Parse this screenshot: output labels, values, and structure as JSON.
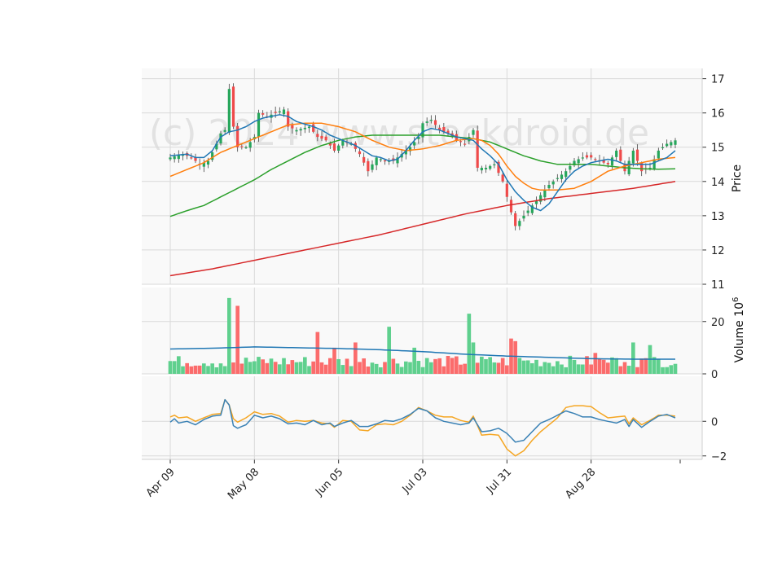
{
  "chart_data": {
    "type": "candlestick",
    "watermark": "(c) 2024 www.stockdroid.de",
    "x_tick_labels": [
      "Apr 09",
      "May 08",
      "Jun 05",
      "Jul 03",
      "Jul 31",
      "Aug 28"
    ],
    "x_tick_index": [
      0,
      20,
      40,
      60,
      80,
      100
    ],
    "n_days": 121,
    "price_panel": {
      "ylabel": "Price",
      "ylim": [
        11,
        17.3
      ],
      "yticks": [
        11,
        12,
        13,
        14,
        15,
        16,
        17
      ],
      "close_anchors": [
        [
          0,
          14.7
        ],
        [
          3,
          14.8
        ],
        [
          5,
          14.7
        ],
        [
          7,
          14.5
        ],
        [
          9,
          14.6
        ],
        [
          11,
          15.1
        ],
        [
          12,
          15.4
        ],
        [
          13,
          15.5
        ],
        [
          14,
          16.7
        ],
        [
          15,
          15.6
        ],
        [
          16,
          15.0
        ],
        [
          18,
          15.0
        ],
        [
          20,
          15.3
        ],
        [
          21,
          16.0
        ],
        [
          23,
          15.9
        ],
        [
          25,
          16.0
        ],
        [
          27,
          16.1
        ],
        [
          28,
          15.6
        ],
        [
          30,
          15.5
        ],
        [
          33,
          15.6
        ],
        [
          35,
          15.3
        ],
        [
          37,
          15.2
        ],
        [
          39,
          14.9
        ],
        [
          41,
          15.2
        ],
        [
          43,
          15.1
        ],
        [
          45,
          14.8
        ],
        [
          47,
          14.3
        ],
        [
          49,
          14.7
        ],
        [
          51,
          14.6
        ],
        [
          53,
          14.6
        ],
        [
          55,
          14.8
        ],
        [
          57,
          15.0
        ],
        [
          59,
          15.3
        ],
        [
          60,
          15.7
        ],
        [
          62,
          15.8
        ],
        [
          64,
          15.5
        ],
        [
          66,
          15.4
        ],
        [
          68,
          15.2
        ],
        [
          70,
          15.1
        ],
        [
          72,
          15.5
        ],
        [
          73,
          14.4
        ],
        [
          75,
          14.4
        ],
        [
          77,
          14.5
        ],
        [
          79,
          14.0
        ],
        [
          81,
          13.1
        ],
        [
          82,
          12.7
        ],
        [
          84,
          13.0
        ],
        [
          86,
          13.3
        ],
        [
          88,
          13.6
        ],
        [
          90,
          13.9
        ],
        [
          92,
          14.1
        ],
        [
          94,
          14.3
        ],
        [
          96,
          14.6
        ],
        [
          98,
          14.7
        ],
        [
          100,
          14.7
        ],
        [
          102,
          14.6
        ],
        [
          104,
          14.5
        ],
        [
          106,
          14.9
        ],
        [
          108,
          14.3
        ],
        [
          110,
          14.9
        ],
        [
          111,
          14.6
        ],
        [
          112,
          14.3
        ],
        [
          114,
          14.4
        ],
        [
          116,
          14.9
        ],
        [
          118,
          15.1
        ],
        [
          120,
          15.2
        ]
      ],
      "ma_fast": [
        [
          0,
          14.75
        ],
        [
          4,
          14.8
        ],
        [
          6,
          14.7
        ],
        [
          8,
          14.7
        ],
        [
          10,
          14.9
        ],
        [
          12,
          15.3
        ],
        [
          14,
          15.45
        ],
        [
          16,
          15.5
        ],
        [
          18,
          15.6
        ],
        [
          20,
          15.75
        ],
        [
          22,
          15.85
        ],
        [
          26,
          15.95
        ],
        [
          28,
          15.9
        ],
        [
          30,
          15.75
        ],
        [
          34,
          15.6
        ],
        [
          36,
          15.5
        ],
        [
          38,
          15.35
        ],
        [
          40,
          15.25
        ],
        [
          44,
          15.05
        ],
        [
          46,
          14.9
        ],
        [
          48,
          14.75
        ],
        [
          50,
          14.7
        ],
        [
          52,
          14.6
        ],
        [
          54,
          14.65
        ],
        [
          56,
          14.9
        ],
        [
          58,
          15.2
        ],
        [
          60,
          15.45
        ],
        [
          62,
          15.55
        ],
        [
          64,
          15.5
        ],
        [
          66,
          15.4
        ],
        [
          68,
          15.3
        ],
        [
          70,
          15.25
        ],
        [
          72,
          15.2
        ],
        [
          74,
          14.95
        ],
        [
          76,
          14.75
        ],
        [
          78,
          14.5
        ],
        [
          80,
          14.05
        ],
        [
          82,
          13.7
        ],
        [
          84,
          13.45
        ],
        [
          86,
          13.25
        ],
        [
          88,
          13.15
        ],
        [
          90,
          13.35
        ],
        [
          92,
          13.7
        ],
        [
          94,
          14.05
        ],
        [
          96,
          14.3
        ],
        [
          98,
          14.45
        ],
        [
          100,
          14.55
        ],
        [
          102,
          14.6
        ],
        [
          104,
          14.65
        ],
        [
          106,
          14.6
        ],
        [
          108,
          14.5
        ],
        [
          110,
          14.5
        ],
        [
          112,
          14.5
        ],
        [
          114,
          14.5
        ],
        [
          116,
          14.6
        ],
        [
          118,
          14.7
        ],
        [
          120,
          14.9
        ]
      ],
      "ma_mid": [
        [
          0,
          14.15
        ],
        [
          4,
          14.35
        ],
        [
          8,
          14.55
        ],
        [
          12,
          14.85
        ],
        [
          16,
          15.05
        ],
        [
          20,
          15.25
        ],
        [
          24,
          15.45
        ],
        [
          28,
          15.65
        ],
        [
          32,
          15.7
        ],
        [
          36,
          15.7
        ],
        [
          40,
          15.6
        ],
        [
          44,
          15.45
        ],
        [
          48,
          15.2
        ],
        [
          52,
          15.0
        ],
        [
          56,
          14.9
        ],
        [
          60,
          14.95
        ],
        [
          64,
          15.05
        ],
        [
          68,
          15.2
        ],
        [
          72,
          15.25
        ],
        [
          74,
          15.2
        ],
        [
          76,
          15.05
        ],
        [
          78,
          14.8
        ],
        [
          80,
          14.45
        ],
        [
          82,
          14.15
        ],
        [
          84,
          13.95
        ],
        [
          86,
          13.8
        ],
        [
          88,
          13.75
        ],
        [
          92,
          13.75
        ],
        [
          96,
          13.8
        ],
        [
          100,
          14.0
        ],
        [
          104,
          14.3
        ],
        [
          108,
          14.45
        ],
        [
          112,
          14.55
        ],
        [
          116,
          14.65
        ],
        [
          120,
          14.7
        ]
      ],
      "ma_slow": [
        [
          0,
          12.98
        ],
        [
          4,
          13.15
        ],
        [
          8,
          13.3
        ],
        [
          12,
          13.55
        ],
        [
          16,
          13.8
        ],
        [
          20,
          14.05
        ],
        [
          24,
          14.35
        ],
        [
          28,
          14.6
        ],
        [
          32,
          14.85
        ],
        [
          36,
          15.05
        ],
        [
          40,
          15.2
        ],
        [
          44,
          15.3
        ],
        [
          48,
          15.35
        ],
        [
          52,
          15.35
        ],
        [
          56,
          15.35
        ],
        [
          60,
          15.35
        ],
        [
          64,
          15.35
        ],
        [
          68,
          15.3
        ],
        [
          72,
          15.25
        ],
        [
          76,
          15.15
        ],
        [
          80,
          14.95
        ],
        [
          84,
          14.75
        ],
        [
          88,
          14.6
        ],
        [
          92,
          14.5
        ],
        [
          96,
          14.5
        ],
        [
          100,
          14.5
        ],
        [
          104,
          14.45
        ],
        [
          108,
          14.4
        ],
        [
          112,
          14.37
        ],
        [
          116,
          14.36
        ],
        [
          120,
          14.37
        ]
      ],
      "ma_long": [
        [
          0,
          11.25
        ],
        [
          10,
          11.45
        ],
        [
          20,
          11.7
        ],
        [
          30,
          11.95
        ],
        [
          40,
          12.2
        ],
        [
          50,
          12.45
        ],
        [
          60,
          12.75
        ],
        [
          70,
          13.05
        ],
        [
          80,
          13.3
        ],
        [
          90,
          13.5
        ],
        [
          100,
          13.65
        ],
        [
          110,
          13.8
        ],
        [
          120,
          14.0
        ]
      ]
    },
    "volume_panel": {
      "ylabel": "Volume",
      "scale_label": "10",
      "scale_exp": "6",
      "ylim": [
        0,
        33
      ],
      "yticks": [
        0,
        20
      ],
      "spikes": [
        [
          11,
          2.5
        ],
        [
          12,
          4.0
        ],
        [
          14,
          29.0
        ],
        [
          16,
          26.0
        ],
        [
          35,
          16.0
        ],
        [
          39,
          10.0
        ],
        [
          44,
          12.0
        ],
        [
          52,
          18.0
        ],
        [
          58,
          10.0
        ],
        [
          71,
          23.0
        ],
        [
          72,
          12.0
        ],
        [
          81,
          13.5
        ],
        [
          82,
          12.5
        ],
        [
          101,
          8.0
        ],
        [
          106,
          6.0
        ],
        [
          108,
          4.5
        ],
        [
          110,
          12.0
        ],
        [
          113,
          6.0
        ],
        [
          114,
          11.0
        ]
      ],
      "avg_anchors": [
        [
          0,
          9.5
        ],
        [
          10,
          9.8
        ],
        [
          20,
          10.3
        ],
        [
          30,
          10.0
        ],
        [
          40,
          9.7
        ],
        [
          50,
          9.2
        ],
        [
          60,
          8.5
        ],
        [
          70,
          7.5
        ],
        [
          80,
          6.8
        ],
        [
          90,
          6.3
        ],
        [
          100,
          5.8
        ],
        [
          110,
          5.6
        ],
        [
          120,
          5.6
        ]
      ]
    },
    "osc_panel": {
      "ylim": [
        -2.2,
        2.6
      ],
      "yticks": [
        -2,
        0
      ],
      "line_a": [
        [
          0,
          -0.05
        ],
        [
          1,
          0.15
        ],
        [
          2,
          -0.1
        ],
        [
          4,
          0
        ],
        [
          6,
          -0.2
        ],
        [
          8,
          0.1
        ],
        [
          10,
          0.3
        ],
        [
          12,
          0.35
        ],
        [
          13,
          1.25
        ],
        [
          14,
          0.95
        ],
        [
          15,
          -0.25
        ],
        [
          16,
          -0.4
        ],
        [
          18,
          -0.2
        ],
        [
          20,
          0.35
        ],
        [
          22,
          0.2
        ],
        [
          24,
          0.3
        ],
        [
          26,
          0.15
        ],
        [
          28,
          -0.15
        ],
        [
          30,
          -0.1
        ],
        [
          32,
          -0.2
        ],
        [
          34,
          0.05
        ],
        [
          36,
          -0.2
        ],
        [
          38,
          -0.1
        ],
        [
          39,
          -0.3
        ],
        [
          41,
          -0.1
        ],
        [
          43,
          0.05
        ],
        [
          45,
          -0.3
        ],
        [
          47,
          -0.3
        ],
        [
          49,
          -0.15
        ],
        [
          51,
          0.05
        ],
        [
          53,
          0
        ],
        [
          55,
          0.15
        ],
        [
          57,
          0.4
        ],
        [
          59,
          0.75
        ],
        [
          61,
          0.6
        ],
        [
          63,
          0.2
        ],
        [
          65,
          0
        ],
        [
          67,
          -0.1
        ],
        [
          69,
          -0.2
        ],
        [
          71,
          -0.1
        ],
        [
          72,
          0.2
        ],
        [
          74,
          -0.6
        ],
        [
          76,
          -0.55
        ],
        [
          78,
          -0.4
        ],
        [
          80,
          -0.7
        ],
        [
          82,
          -1.2
        ],
        [
          84,
          -1.1
        ],
        [
          86,
          -0.6
        ],
        [
          88,
          -0.1
        ],
        [
          90,
          0.1
        ],
        [
          92,
          0.35
        ],
        [
          94,
          0.6
        ],
        [
          96,
          0.45
        ],
        [
          98,
          0.25
        ],
        [
          100,
          0.25
        ],
        [
          102,
          0.1
        ],
        [
          104,
          0
        ],
        [
          106,
          -0.1
        ],
        [
          108,
          0.1
        ],
        [
          109,
          -0.3
        ],
        [
          110,
          0.1
        ],
        [
          112,
          -0.35
        ],
        [
          114,
          0
        ],
        [
          116,
          0.3
        ],
        [
          118,
          0.4
        ],
        [
          120,
          0.2
        ]
      ],
      "line_b": [
        [
          0,
          0.25
        ],
        [
          1,
          0.35
        ],
        [
          2,
          0.2
        ],
        [
          4,
          0.25
        ],
        [
          6,
          0
        ],
        [
          8,
          0.2
        ],
        [
          10,
          0.4
        ],
        [
          12,
          0.45
        ],
        [
          13,
          1.25
        ],
        [
          14,
          0.95
        ],
        [
          15,
          0.15
        ],
        [
          16,
          -0.05
        ],
        [
          18,
          0.2
        ],
        [
          20,
          0.55
        ],
        [
          22,
          0.4
        ],
        [
          24,
          0.45
        ],
        [
          26,
          0.3
        ],
        [
          28,
          -0.05
        ],
        [
          30,
          0.05
        ],
        [
          32,
          0
        ],
        [
          34,
          0.05
        ],
        [
          36,
          -0.1
        ],
        [
          38,
          -0.15
        ],
        [
          39,
          -0.35
        ],
        [
          41,
          0.05
        ],
        [
          43,
          0
        ],
        [
          45,
          -0.5
        ],
        [
          47,
          -0.55
        ],
        [
          49,
          -0.2
        ],
        [
          51,
          -0.15
        ],
        [
          53,
          -0.2
        ],
        [
          55,
          0
        ],
        [
          57,
          0.35
        ],
        [
          59,
          0.8
        ],
        [
          61,
          0.6
        ],
        [
          63,
          0.35
        ],
        [
          65,
          0.25
        ],
        [
          67,
          0.25
        ],
        [
          69,
          0.05
        ],
        [
          71,
          -0.05
        ],
        [
          72,
          0.3
        ],
        [
          74,
          -0.8
        ],
        [
          76,
          -0.75
        ],
        [
          78,
          -0.8
        ],
        [
          80,
          -1.6
        ],
        [
          82,
          -2.0
        ],
        [
          84,
          -1.7
        ],
        [
          86,
          -1.1
        ],
        [
          88,
          -0.6
        ],
        [
          90,
          -0.2
        ],
        [
          92,
          0.2
        ],
        [
          94,
          0.8
        ],
        [
          96,
          0.9
        ],
        [
          98,
          0.9
        ],
        [
          100,
          0.85
        ],
        [
          102,
          0.5
        ],
        [
          104,
          0.2
        ],
        [
          106,
          0.25
        ],
        [
          108,
          0.3
        ],
        [
          109,
          -0.15
        ],
        [
          110,
          0.2
        ],
        [
          112,
          -0.2
        ],
        [
          114,
          0.05
        ],
        [
          116,
          0.35
        ],
        [
          118,
          0.35
        ],
        [
          120,
          0.3
        ]
      ]
    },
    "colors": {
      "up": "#26a65b",
      "down": "#ef4a4a",
      "up_vol": "#5fd08e",
      "down_vol": "#fb6c6c",
      "ma_fast": "#1f77b4",
      "ma_mid": "#ff7f0e",
      "ma_slow": "#2ca02c",
      "ma_long": "#d62728",
      "vol_avg": "#1f77b4",
      "osc_a": "#3b82b5",
      "osc_b": "#f5a623",
      "panel_bg": "#f9f9f9",
      "grid": "#d9d9d9"
    }
  }
}
